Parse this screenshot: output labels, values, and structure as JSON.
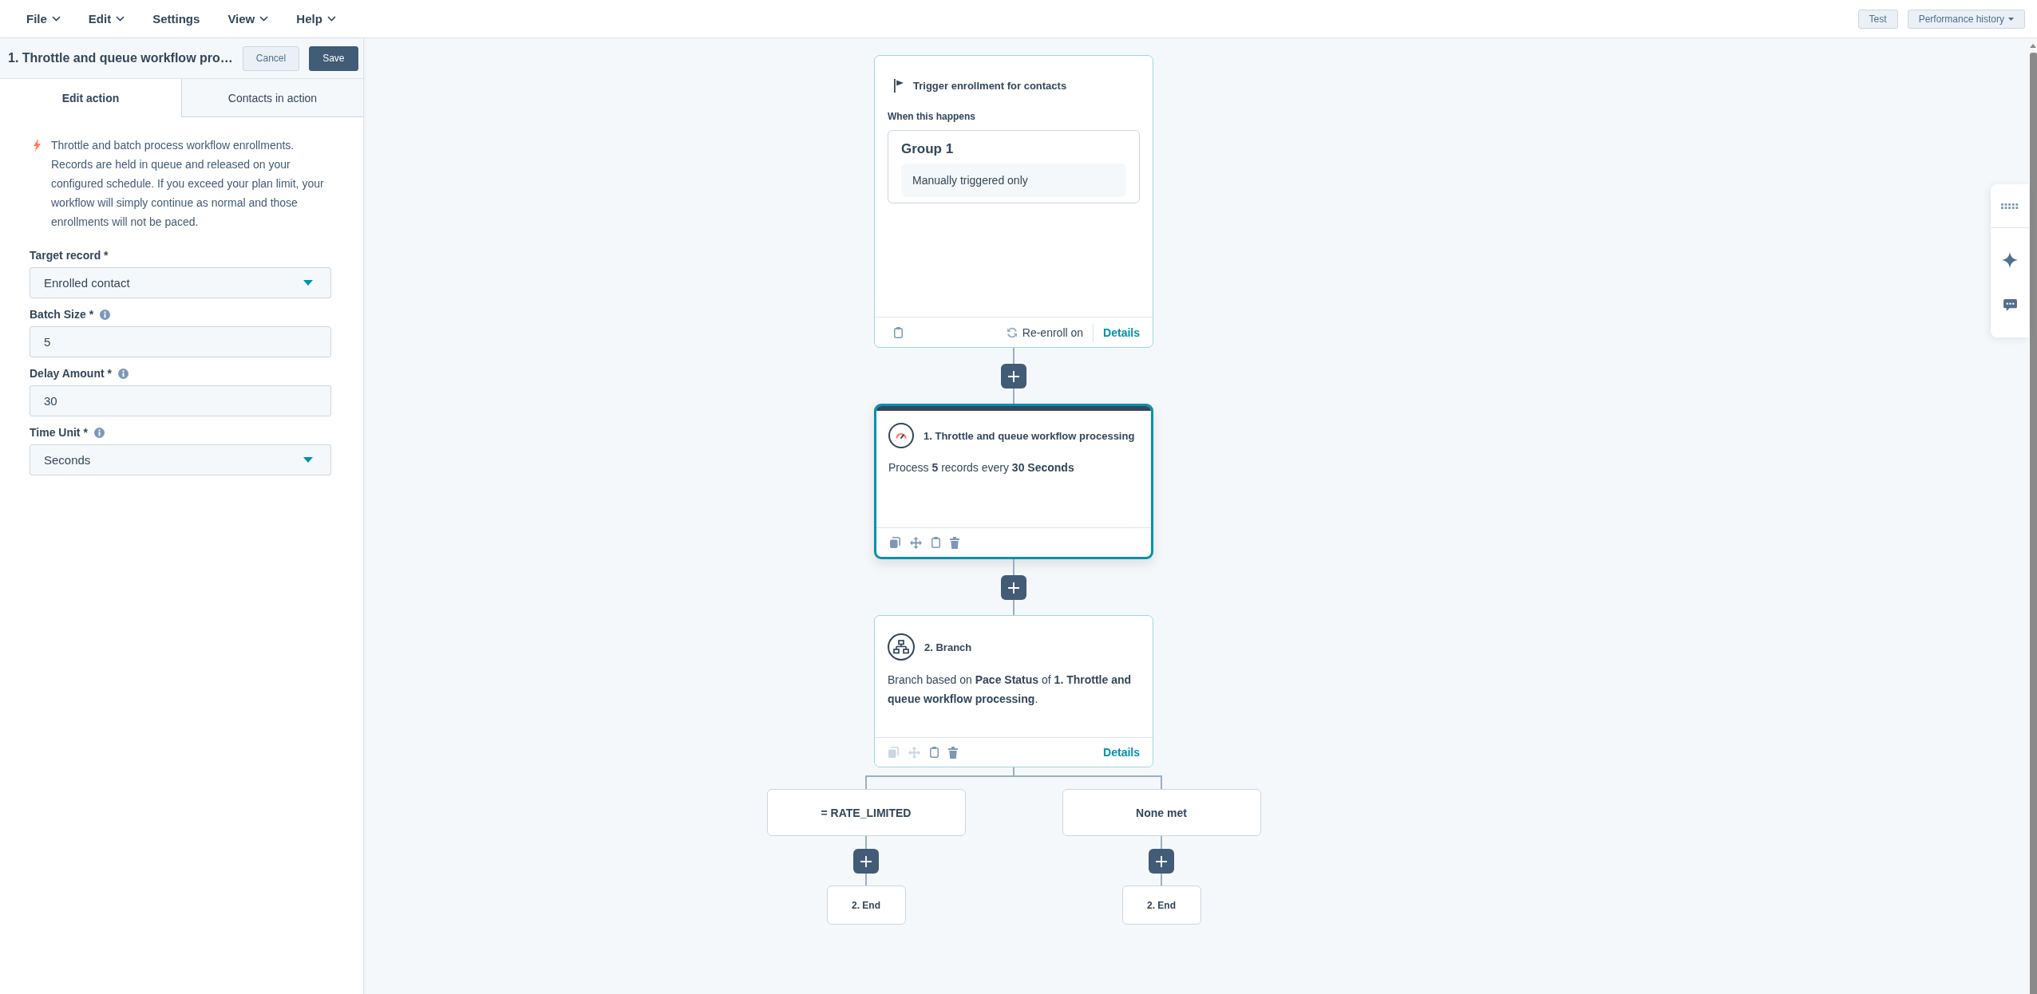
{
  "menu": [
    {
      "label": "File",
      "has_menu": true
    },
    {
      "label": "Edit",
      "has_menu": true
    },
    {
      "label": "Settings",
      "has_menu": false
    },
    {
      "label": "View",
      "has_menu": true
    },
    {
      "label": "Help",
      "has_menu": true
    }
  ],
  "toolbar_buttons": [
    {
      "label": "Test",
      "dropdown": false
    },
    {
      "label": "Performance history",
      "dropdown": true
    }
  ],
  "panel": {
    "title": "1. Throttle and queue workflow pro…",
    "buttons": [
      {
        "label": "Cancel",
        "kind": "secondary"
      },
      {
        "label": "Save",
        "kind": "primary"
      }
    ],
    "tabs": [
      {
        "label": "Edit action",
        "selected": true
      },
      {
        "label": "Contacts in action",
        "selected": false
      }
    ],
    "description": "Throttle and batch process workflow enrollments. Records are held in queue and released on your configured schedule. If you exceed your plan limit, your workflow will simply continue as normal and those enrollments will not be paced.",
    "fields": [
      {
        "label": "Target record *",
        "kind": "select",
        "value": "Enrolled contact",
        "info": false
      },
      {
        "label": "Batch Size *",
        "kind": "input",
        "value": "5",
        "info": true
      },
      {
        "label": "Delay Amount *",
        "kind": "input",
        "value": "30",
        "info": true
      },
      {
        "label": "Time Unit *",
        "kind": "select",
        "value": "Seconds",
        "info": true
      }
    ]
  },
  "canvas": {
    "trigger": {
      "title": "Trigger enrollment for contacts",
      "section_label": "When this happens",
      "group_title": "Group 1",
      "condition": "Manually triggered only",
      "reenroll": "Re-enroll on",
      "details_link": "Details"
    },
    "actions": [
      {
        "kind": "throttle",
        "title": "1. Throttle and queue workflow processing",
        "summary": "Process **5** records every **30 Seconds**",
        "selected": true,
        "tools": [
          {
            "kind": "copy",
            "disabled": false
          },
          {
            "kind": "move",
            "disabled": false
          },
          {
            "kind": "clipboard",
            "disabled": false
          },
          {
            "kind": "trash",
            "disabled": false
          }
        ]
      },
      {
        "kind": "branch",
        "title": "2. Branch",
        "summary": "Branch based on **Pace Status** of **1. Throttle and queue workflow processing**.",
        "selected": false,
        "tools": [
          {
            "kind": "copy",
            "disabled": true
          },
          {
            "kind": "move",
            "disabled": true
          },
          {
            "kind": "clipboard",
            "disabled": false
          },
          {
            "kind": "trash",
            "disabled": false
          }
        ],
        "details": "Details"
      }
    ],
    "branches": [
      {
        "label": "= RATE_LIMITED",
        "end": "2. End"
      },
      {
        "label": "None met",
        "end": "2. End"
      }
    ]
  }
}
